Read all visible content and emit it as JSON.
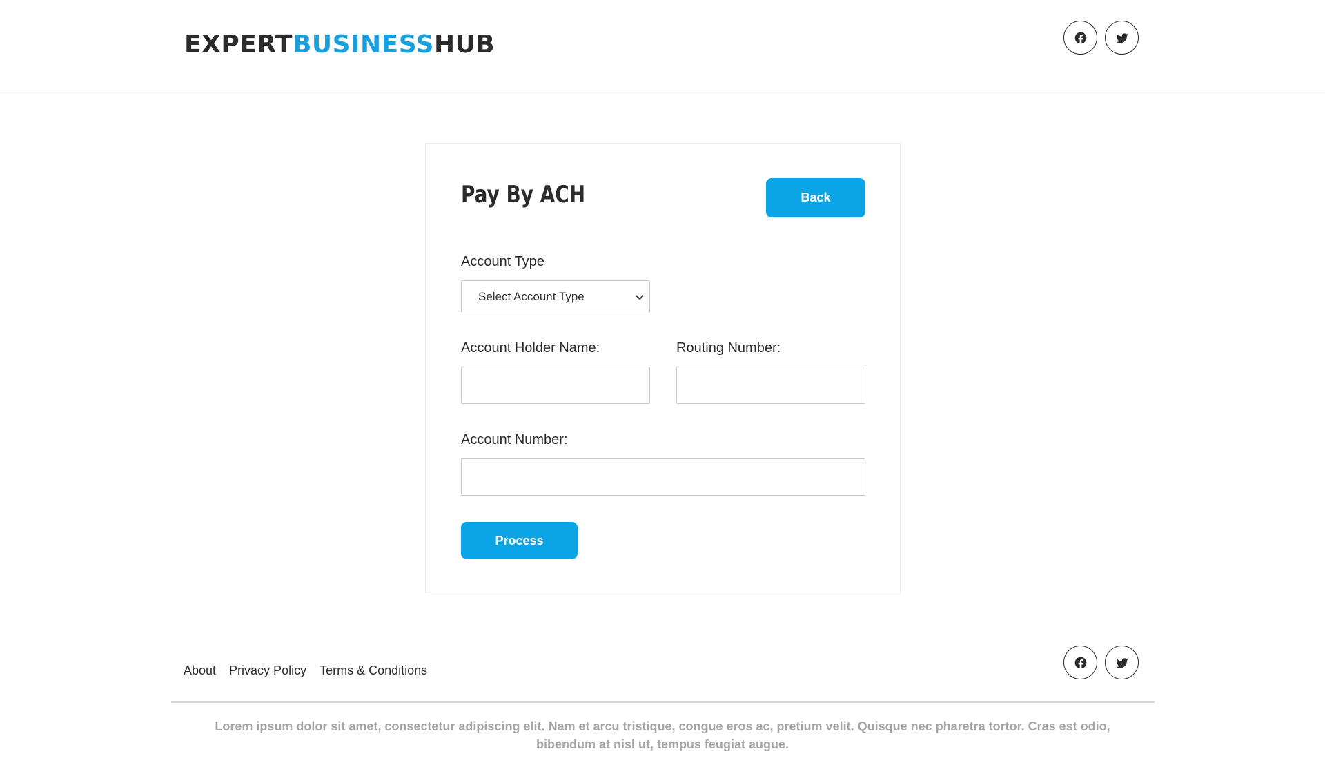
{
  "header": {
    "logo": {
      "part1": "EXPERT",
      "part2": "BUSINESS",
      "part3": "HUB"
    }
  },
  "social": [
    {
      "icon": "facebook-icon"
    },
    {
      "icon": "twitter-icon"
    }
  ],
  "form": {
    "title": "Pay By ACH",
    "back_label": "Back",
    "account_type_label": "Account Type",
    "account_type_selected": "Select Account Type",
    "holder_name_label": "Account Holder Name:",
    "holder_name_value": "",
    "routing_label": "Routing Number:",
    "routing_value": "",
    "account_number_label": "Account Number:",
    "account_number_value": "",
    "process_label": "Process"
  },
  "footer": {
    "links": [
      "About",
      "Privacy Policy",
      "Terms & Conditions"
    ],
    "text": "Lorem ipsum dolor sit amet, consectetur adipiscing elit. Nam et arcu tristique, congue eros ac, pretium velit. Quisque nec pharetra tortor. Cras est odio, bibendum at nisl ut, tempus feugiat augue."
  },
  "colors": {
    "accent": "#0ba4e5",
    "logo_accent": "#1a9fdd",
    "text": "#2b2b2b",
    "footer_text": "#a5a5a5"
  }
}
